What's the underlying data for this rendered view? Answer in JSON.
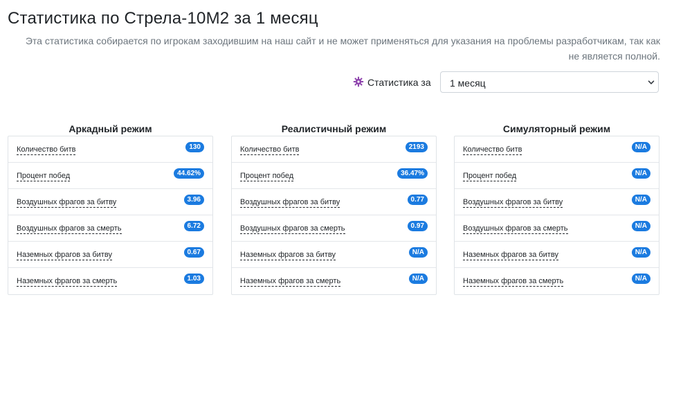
{
  "page": {
    "title": "Статистика по Стрела-10М2 за 1 месяц",
    "description": "Эта статистика собирается по игрокам заходившим на наш сайт и не может применяться для указания на проблемы разработчикам, так как не является полной."
  },
  "period": {
    "icon": "gear-icon",
    "label": "Статистика за",
    "selected": "1 месяц"
  },
  "colors": {
    "badge": "#1b7be0",
    "icon": "#8e44ad"
  },
  "modes": [
    {
      "title": "Аркадный режим",
      "stats": [
        {
          "label": "Количество битв",
          "value": "130"
        },
        {
          "label": "Процент побед",
          "value": "44.62%"
        },
        {
          "label": "Воздушных фрагов за битву",
          "value": "3.96"
        },
        {
          "label": "Воздушных фрагов за смерть",
          "value": "6.72"
        },
        {
          "label": "Наземных фрагов за битву",
          "value": "0.67"
        },
        {
          "label": "Наземных фрагов за смерть",
          "value": "1.03"
        }
      ]
    },
    {
      "title": "Реалистичный режим",
      "stats": [
        {
          "label": "Количество битв",
          "value": "2193"
        },
        {
          "label": "Процент побед",
          "value": "36.47%"
        },
        {
          "label": "Воздушных фрагов за битву",
          "value": "0.77"
        },
        {
          "label": "Воздушных фрагов за смерть",
          "value": "0.97"
        },
        {
          "label": "Наземных фрагов за битву",
          "value": "N/A"
        },
        {
          "label": "Наземных фрагов за смерть",
          "value": "N/A"
        }
      ]
    },
    {
      "title": "Симуляторный режим",
      "stats": [
        {
          "label": "Количество битв",
          "value": "N/A"
        },
        {
          "label": "Процент побед",
          "value": "N/A"
        },
        {
          "label": "Воздушных фрагов за битву",
          "value": "N/A"
        },
        {
          "label": "Воздушных фрагов за смерть",
          "value": "N/A"
        },
        {
          "label": "Наземных фрагов за битву",
          "value": "N/A"
        },
        {
          "label": "Наземных фрагов за смерть",
          "value": "N/A"
        }
      ]
    }
  ]
}
